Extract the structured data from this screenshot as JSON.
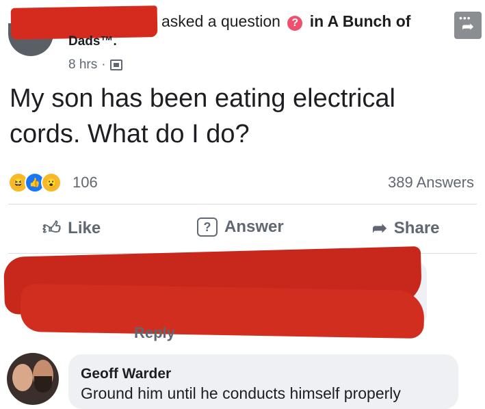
{
  "post": {
    "header_text": "asked a question",
    "header_in": "in A Bunch of",
    "group_name_cont": "Dads™.",
    "time": "8 hrs",
    "meta_separator": "·",
    "question": "My son has been eating electrical cords. What do I do?",
    "reaction_count": "106",
    "answers_count": "389 Answers",
    "reactions": [
      "haha",
      "like",
      "wow"
    ]
  },
  "actions": {
    "like": "Like",
    "answer": "Answer",
    "share": "Share"
  },
  "redacted_comment": {
    "reply_label": "Reply"
  },
  "comment": {
    "author": "Geoff Warder",
    "text": "Ground him until he conducts himself properly"
  },
  "colors": {
    "redaction": "#d52b1e",
    "question_badge": "#f0506e",
    "text_secondary": "#606770",
    "bubble": "#eef0f3"
  }
}
